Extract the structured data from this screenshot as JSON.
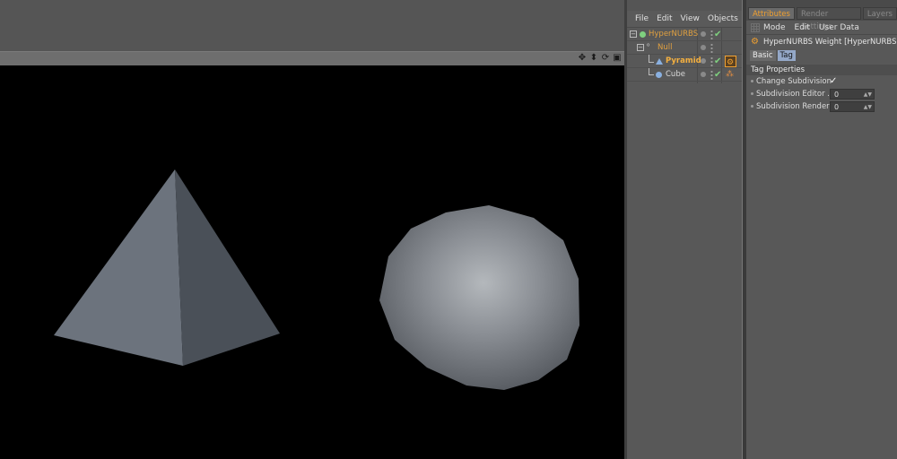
{
  "object_manager": {
    "menu": [
      "File",
      "Edit",
      "View",
      "Objects"
    ],
    "objects": [
      {
        "name": "HyperNURBS",
        "color": "#e0a040"
      },
      {
        "name": "Null",
        "color": "#e0a040"
      },
      {
        "name": "Pyramid",
        "color": "#f4b040"
      },
      {
        "name": "Cube",
        "color": "#d8d8d8"
      }
    ]
  },
  "attributes": {
    "tabs": [
      "Attributes",
      "Render Settings",
      "Layers"
    ],
    "menu": [
      "Mode",
      "Edit",
      "User Data"
    ],
    "title": "HyperNURBS Weight [HyperNURBS Wei",
    "subtabs": [
      "Basic",
      "Tag"
    ],
    "section": "Tag Properties",
    "props": [
      {
        "label": "Change Subdivision",
        "value": "✓"
      },
      {
        "label": "Subdivision Editor . .",
        "value": "0"
      },
      {
        "label": "Subdivision Renderer",
        "value": "0"
      }
    ]
  },
  "colors": {
    "accent_orange": "#f0a030",
    "active_subtab": "#94a8c8",
    "viewport_bg": "#000000"
  }
}
